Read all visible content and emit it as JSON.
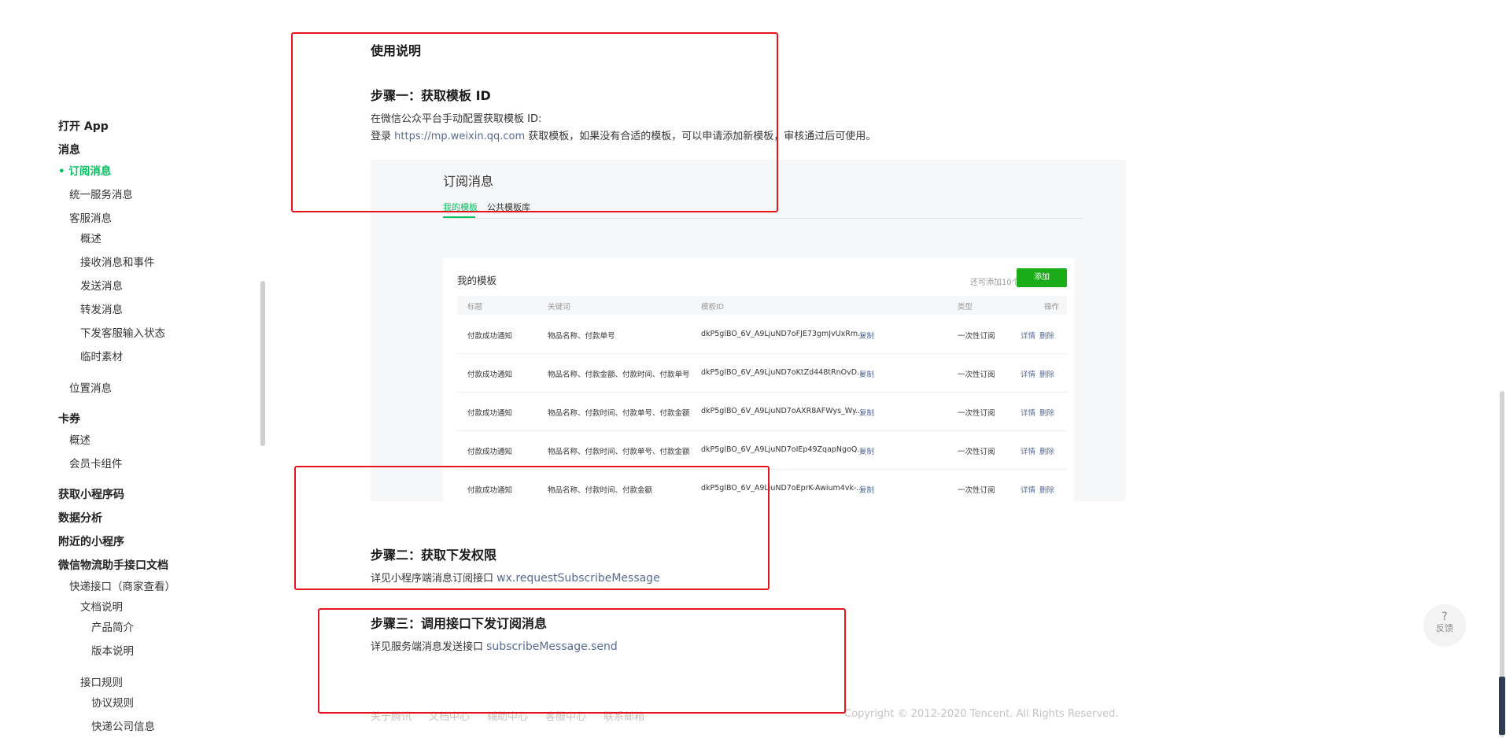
{
  "sidebar": {
    "items": [
      {
        "label": "打开 App"
      },
      {
        "label": "消息"
      },
      {
        "label": "• 订阅消息"
      },
      {
        "label": "统一服务消息"
      },
      {
        "label": "客服消息"
      },
      {
        "label": "概述"
      },
      {
        "label": "接收消息和事件"
      },
      {
        "label": "发送消息"
      },
      {
        "label": "转发消息"
      },
      {
        "label": "下发客服输入状态"
      },
      {
        "label": "临时素材"
      },
      {
        "label": "位置消息"
      },
      {
        "label": "卡券"
      },
      {
        "label": "概述"
      },
      {
        "label": "会员卡组件"
      },
      {
        "label": "获取小程序码"
      },
      {
        "label": "数据分析"
      },
      {
        "label": "附近的小程序"
      },
      {
        "label": "微信物流助手接口文档"
      },
      {
        "label": "快递接口（商家查看）"
      },
      {
        "label": "文档说明"
      },
      {
        "label": "产品简介"
      },
      {
        "label": "版本说明"
      },
      {
        "label": "接口规则"
      },
      {
        "label": "协议规则"
      },
      {
        "label": "快递公司信息"
      }
    ]
  },
  "content": {
    "title": "使用说明",
    "step1": {
      "heading": "步骤一：获取模板 ID",
      "line1": "在微信公众平台手动配置获取模板 ID:",
      "line2_prefix": "登录 ",
      "line2_link": "https://mp.weixin.qq.com",
      "line2_suffix": " 获取模板，如果没有合适的模板，可以申请添加新模板，审核通过后可使用。"
    },
    "step2": {
      "heading": "步骤二：获取下发权限",
      "text_prefix": "详见小程序端消息订阅接口 ",
      "link": "wx.requestSubscribeMessage"
    },
    "step3": {
      "heading": "步骤三：调用接口下发订阅消息",
      "text_prefix": "详见服务端消息发送接口 ",
      "link": "subscribeMessage.send"
    }
  },
  "panel": {
    "title": "订阅消息",
    "tabs": [
      {
        "label": "我的模板"
      },
      {
        "label": "公共模板库"
      }
    ],
    "card": {
      "title": "我的模板",
      "remaining": "还可添加10个",
      "add_label": "添加",
      "columns": [
        "标题",
        "关键词",
        "模板ID",
        "类型",
        "操作"
      ],
      "rows": [
        {
          "title": "付款成功通知",
          "keywords": "物品名称、付款单号",
          "template_id": "dkP5glBO_6V_A9LjuND7oFJE73gmJvUxRm...",
          "copy": "复制",
          "type": "一次性订阅",
          "detail": "详情",
          "delete": "删除"
        },
        {
          "title": "付款成功通知",
          "keywords": "物品名称、付款金额、付款时间、付款单号",
          "template_id": "dkP5glBO_6V_A9LjuND7oKtZd448tRnOvD...",
          "copy": "复制",
          "type": "一次性订阅",
          "detail": "详情",
          "delete": "删除"
        },
        {
          "title": "付款成功通知",
          "keywords": "物品名称、付款时间、付款单号、付款金额",
          "template_id": "dkP5glBO_6V_A9LjuND7oAXR8AFWys_Wy...",
          "copy": "复制",
          "type": "一次性订阅",
          "detail": "详情",
          "delete": "删除"
        },
        {
          "title": "付款成功通知",
          "keywords": "物品名称、付款时间、付款单号、付款金额",
          "template_id": "dkP5glBO_6V_A9LjuND7oIEp49ZqapNgoQ...",
          "copy": "复制",
          "type": "一次性订阅",
          "detail": "详情",
          "delete": "删除"
        },
        {
          "title": "付款成功通知",
          "keywords": "物品名称、付款时间、付款金额",
          "template_id": "dkP5glBO_6V_A9LjuND7oEprK-Awium4vk-...",
          "copy": "复制",
          "type": "一次性订阅",
          "detail": "详情",
          "delete": "删除"
        }
      ]
    }
  },
  "feedback": {
    "icon_glyph": "?",
    "label": "反馈"
  },
  "footer": {
    "links": [
      "关于腾讯",
      "文档中心",
      "辅助中心",
      "客服中心",
      "联系邮箱"
    ],
    "copyright": "Copyright © 2012-2020 Tencent. All Rights Reserved."
  },
  "colors": {
    "accent": "#07c160",
    "link": "#576b95",
    "annotation": "#e6151b"
  }
}
